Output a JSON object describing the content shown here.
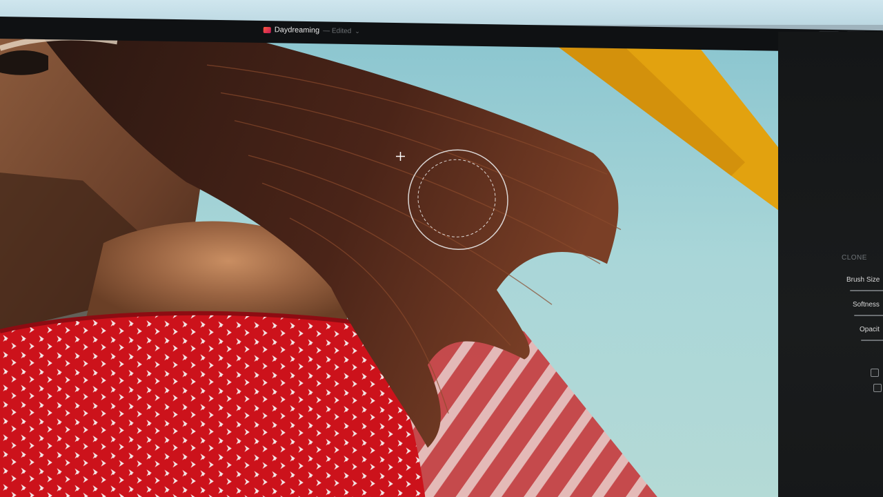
{
  "window": {
    "title": "Daydreaming",
    "status": "— Edited",
    "title_chevron": "⌄"
  },
  "toolbar": {
    "icons": [
      "crop-icon",
      "document-icon",
      "grid-icon"
    ]
  },
  "inspector": {
    "section_title": "CLONE",
    "rows": {
      "brush_size": "Brush Size",
      "softness": "Softness",
      "opacity": "Opacit"
    }
  },
  "colors": {
    "sky": "#a9d6d8",
    "dress_red": "#d0141c",
    "sail_yellow": "#e6a80e",
    "panel_bg": "#141617",
    "titlebar_bg": "#0f1113"
  }
}
